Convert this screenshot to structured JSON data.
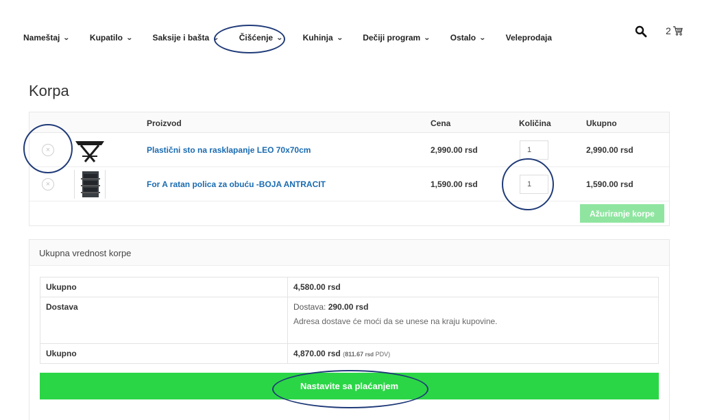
{
  "nav": {
    "items": [
      {
        "label": "Nameštaj",
        "chev": "⌄"
      },
      {
        "label": "Kupatilo",
        "chev": "⌄"
      },
      {
        "label": "Saksije i bašta",
        "chev": "⌄"
      },
      {
        "label": "Čišćenje",
        "chev": "⌄"
      },
      {
        "label": "Kuhinja",
        "chev": "⌄"
      },
      {
        "label": "Dečiji program",
        "chev": "⌄"
      },
      {
        "label": "Ostalo",
        "chev": "⌄"
      },
      {
        "label": "Veleprodaja"
      }
    ],
    "search_icon": "search-icon",
    "cart_count": "2",
    "cart_icon": "cart-icon"
  },
  "page": {
    "title": "Korpa"
  },
  "cart": {
    "headers": {
      "product": "Proizvod",
      "price": "Cena",
      "quantity": "Količina",
      "total": "Ukupno"
    },
    "rows": [
      {
        "remove": "×",
        "name": "Plastični sto na rasklapanje LEO 70x70cm",
        "price": "2,990.00 rsd",
        "quantity": "1",
        "subtotal": "2,990.00 rsd"
      },
      {
        "remove": "×",
        "name": "For A ratan polica za obuću -BOJA ANTRACIT",
        "price": "1,590.00 rsd",
        "quantity": "1",
        "subtotal": "1,590.00 rsd"
      }
    ],
    "update_label": "Ažuriranje korpe",
    "update_color": "#8fe5a0"
  },
  "totals": {
    "heading": "Ukupna vrednost korpe",
    "subtotal_label": "Ukupno",
    "subtotal_value": "4,580.00 rsd",
    "shipping_label": "Dostava",
    "shipping_prefix": "Dostava:",
    "shipping_value": "290.00 rsd",
    "shipping_note": "Adresa dostave će moći da se unese na kraju kupovine.",
    "total_label": "Ukupno",
    "total_value": "4,870.00 rsd",
    "tax_open": "(",
    "tax_value": "811.67",
    "tax_currency": "rsd",
    "tax_suffix": "PDV)",
    "checkout_label": "Nastavite sa plaćanjem",
    "checkout_color": "#2bd646"
  },
  "colors": {
    "link": "#1a6bb0",
    "annotation": "#1f3a78"
  }
}
